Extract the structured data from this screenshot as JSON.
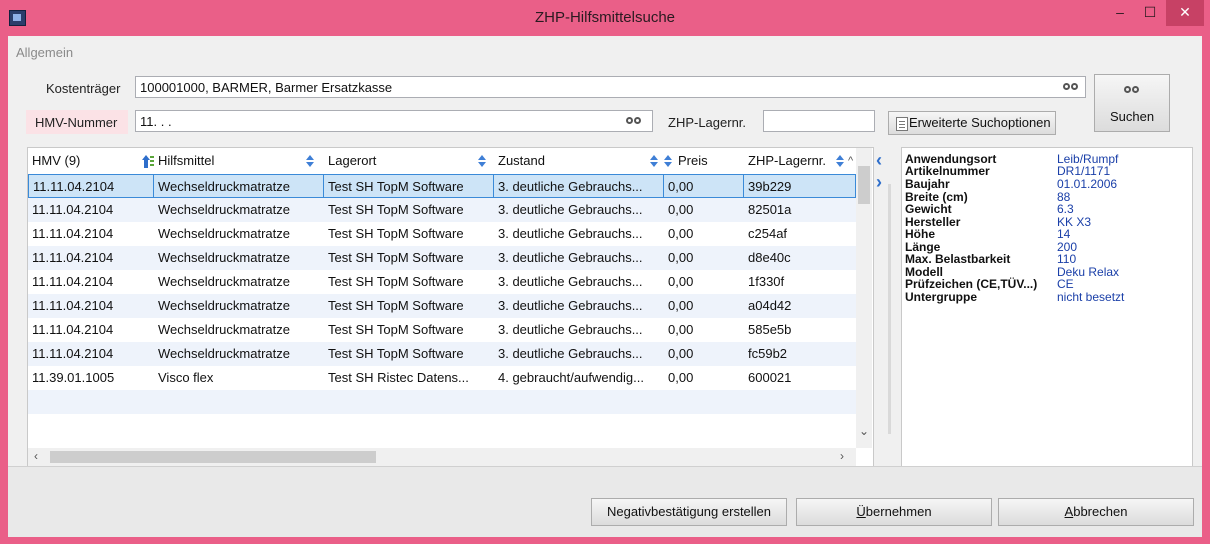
{
  "window": {
    "title": "ZHP-Hilfsmittelsuche",
    "minimize": "–",
    "maximize": "☐",
    "close": "✕"
  },
  "section": "Allgemein",
  "form": {
    "kostentraeger_label": "Kostenträger",
    "kostentraeger_value": "100001000, BARMER, Barmer Ersatzkasse",
    "hmv_label": "HMV-Nummer",
    "hmv_value": "11.   .   .",
    "lager_label": "ZHP-Lagernr.",
    "lager_value": "",
    "ext_search": "Erweiterte Suchoptionen",
    "search": "Suchen"
  },
  "grid": {
    "columns": [
      "HMV (9)",
      "Hilfsmittel",
      "Lagerort",
      "Zustand",
      "Preis",
      "ZHP-Lagernr."
    ],
    "rows": [
      [
        "11.11.04.2104",
        "Wechseldruckmatratze",
        "Test SH TopM Software",
        "3. deutliche Gebrauchs...",
        "0,00",
        "39b229"
      ],
      [
        "11.11.04.2104",
        "Wechseldruckmatratze",
        "Test SH TopM Software",
        "3. deutliche Gebrauchs...",
        "0,00",
        "82501a"
      ],
      [
        "11.11.04.2104",
        "Wechseldruckmatratze",
        "Test SH TopM Software",
        "3. deutliche Gebrauchs...",
        "0,00",
        "c254af"
      ],
      [
        "11.11.04.2104",
        "Wechseldruckmatratze",
        "Test SH TopM Software",
        "3. deutliche Gebrauchs...",
        "0,00",
        "d8e40c"
      ],
      [
        "11.11.04.2104",
        "Wechseldruckmatratze",
        "Test SH TopM Software",
        "3. deutliche Gebrauchs...",
        "0,00",
        "1f330f"
      ],
      [
        "11.11.04.2104",
        "Wechseldruckmatratze",
        "Test SH TopM Software",
        "3. deutliche Gebrauchs...",
        "0,00",
        "a04d42"
      ],
      [
        "11.11.04.2104",
        "Wechseldruckmatratze",
        "Test SH TopM Software",
        "3. deutliche Gebrauchs...",
        "0,00",
        "585e5b"
      ],
      [
        "11.11.04.2104",
        "Wechseldruckmatratze",
        "Test SH TopM Software",
        "3. deutliche Gebrauchs...",
        "0,00",
        "fc59b2"
      ],
      [
        "11.39.01.1005",
        "Visco flex",
        "Test SH Ristec Datens...",
        "4. gebraucht/aufwendig...",
        "0,00",
        "600021"
      ]
    ]
  },
  "properties": [
    {
      "k": "Anwendungsort",
      "v": "Leib/Rumpf"
    },
    {
      "k": "Artikelnummer",
      "v": "DR1/1171"
    },
    {
      "k": "Baujahr",
      "v": "01.01.2006"
    },
    {
      "k": "Breite (cm)",
      "v": "88"
    },
    {
      "k": "Gewicht",
      "v": "6.3"
    },
    {
      "k": "Hersteller",
      "v": "KK X3"
    },
    {
      "k": "Höhe",
      "v": "14"
    },
    {
      "k": "Länge",
      "v": "200"
    },
    {
      "k": "Max. Belastbarkeit",
      "v": "110"
    },
    {
      "k": "Modell",
      "v": "Deku Relax"
    },
    {
      "k": "Prüfzeichen (CE,TÜV...)",
      "v": "CE"
    },
    {
      "k": "Untergruppe",
      "v": "nicht besetzt"
    }
  ],
  "footer": {
    "negativ": "Negativbestätigung erstellen",
    "uebernehmen_u": "Ü",
    "uebernehmen_rest": "bernehmen",
    "abbrechen_u": "A",
    "abbrechen_rest": "bbrechen"
  }
}
